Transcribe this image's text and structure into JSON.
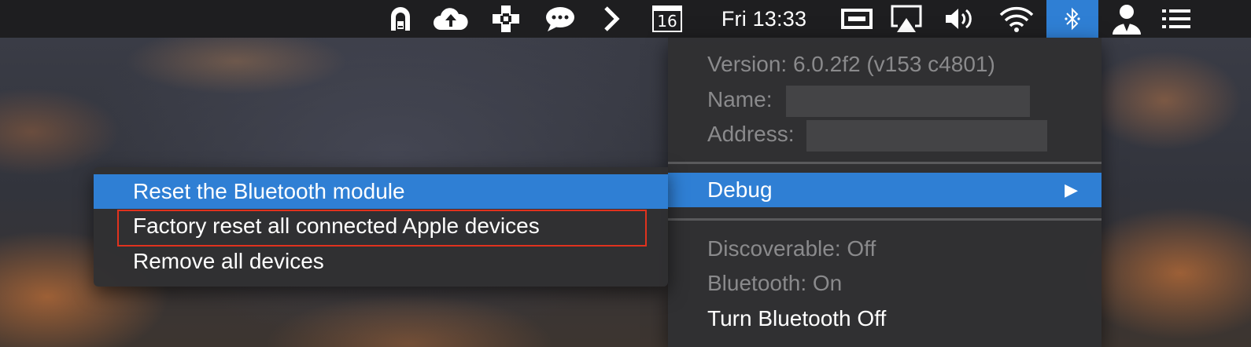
{
  "menubar": {
    "clock": "Fri 13:33",
    "calendar_day": "16",
    "icons": [
      "archive-icon",
      "cloud-upload-icon",
      "plus-badge-icon",
      "chat-bubble-icon",
      "chevron-right-icon",
      "calendar-icon",
      "display-icon",
      "airplay-icon",
      "volume-icon",
      "wifi-icon",
      "bluetooth-icon",
      "user-icon",
      "list-icon"
    ]
  },
  "bluetooth_menu": {
    "info": [
      {
        "label": "Version: 6.0.2f2 (v153 c4801)"
      },
      {
        "label": "Name:"
      },
      {
        "label": "Address:"
      }
    ],
    "debug_label": "Debug",
    "status": [
      {
        "label": "Discoverable: Off"
      },
      {
        "label": "Bluetooth: On"
      }
    ],
    "turn_off_label": "Turn Bluetooth Off"
  },
  "debug_submenu": {
    "items": [
      {
        "label": "Reset the Bluetooth module"
      },
      {
        "label": "Factory reset all connected Apple devices"
      },
      {
        "label": "Remove all devices"
      }
    ]
  },
  "colors": {
    "highlight": "#2f7fd4",
    "callout": "#e0321e",
    "menubar": "#1e1e20"
  }
}
